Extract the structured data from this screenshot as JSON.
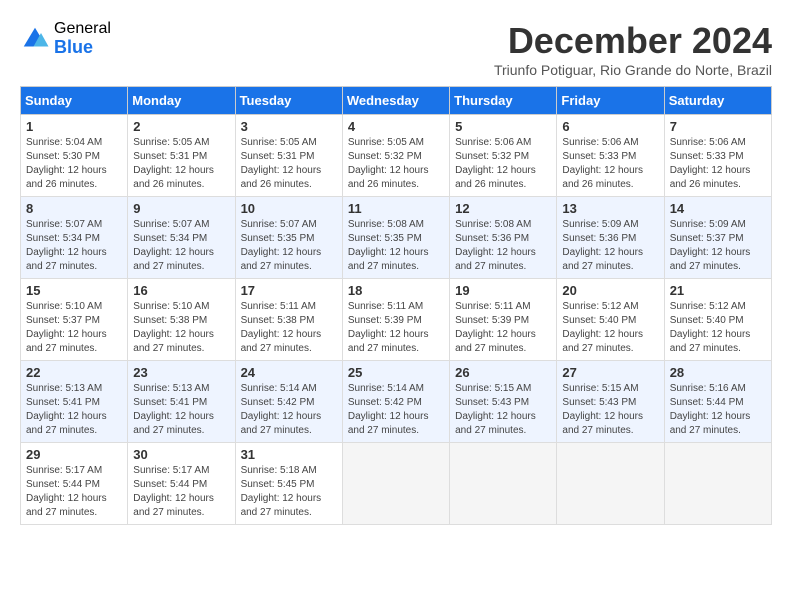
{
  "logo": {
    "general": "General",
    "blue": "Blue"
  },
  "title": "December 2024",
  "subtitle": "Triunfo Potiguar, Rio Grande do Norte, Brazil",
  "weekdays": [
    "Sunday",
    "Monday",
    "Tuesday",
    "Wednesday",
    "Thursday",
    "Friday",
    "Saturday"
  ],
  "weeks": [
    [
      {
        "day": "1",
        "sunrise": "5:04 AM",
        "sunset": "5:30 PM",
        "daylight": "12 hours and 26 minutes."
      },
      {
        "day": "2",
        "sunrise": "5:05 AM",
        "sunset": "5:31 PM",
        "daylight": "12 hours and 26 minutes."
      },
      {
        "day": "3",
        "sunrise": "5:05 AM",
        "sunset": "5:31 PM",
        "daylight": "12 hours and 26 minutes."
      },
      {
        "day": "4",
        "sunrise": "5:05 AM",
        "sunset": "5:32 PM",
        "daylight": "12 hours and 26 minutes."
      },
      {
        "day": "5",
        "sunrise": "5:06 AM",
        "sunset": "5:32 PM",
        "daylight": "12 hours and 26 minutes."
      },
      {
        "day": "6",
        "sunrise": "5:06 AM",
        "sunset": "5:33 PM",
        "daylight": "12 hours and 26 minutes."
      },
      {
        "day": "7",
        "sunrise": "5:06 AM",
        "sunset": "5:33 PM",
        "daylight": "12 hours and 26 minutes."
      }
    ],
    [
      {
        "day": "8",
        "sunrise": "5:07 AM",
        "sunset": "5:34 PM",
        "daylight": "12 hours and 27 minutes."
      },
      {
        "day": "9",
        "sunrise": "5:07 AM",
        "sunset": "5:34 PM",
        "daylight": "12 hours and 27 minutes."
      },
      {
        "day": "10",
        "sunrise": "5:07 AM",
        "sunset": "5:35 PM",
        "daylight": "12 hours and 27 minutes."
      },
      {
        "day": "11",
        "sunrise": "5:08 AM",
        "sunset": "5:35 PM",
        "daylight": "12 hours and 27 minutes."
      },
      {
        "day": "12",
        "sunrise": "5:08 AM",
        "sunset": "5:36 PM",
        "daylight": "12 hours and 27 minutes."
      },
      {
        "day": "13",
        "sunrise": "5:09 AM",
        "sunset": "5:36 PM",
        "daylight": "12 hours and 27 minutes."
      },
      {
        "day": "14",
        "sunrise": "5:09 AM",
        "sunset": "5:37 PM",
        "daylight": "12 hours and 27 minutes."
      }
    ],
    [
      {
        "day": "15",
        "sunrise": "5:10 AM",
        "sunset": "5:37 PM",
        "daylight": "12 hours and 27 minutes."
      },
      {
        "day": "16",
        "sunrise": "5:10 AM",
        "sunset": "5:38 PM",
        "daylight": "12 hours and 27 minutes."
      },
      {
        "day": "17",
        "sunrise": "5:11 AM",
        "sunset": "5:38 PM",
        "daylight": "12 hours and 27 minutes."
      },
      {
        "day": "18",
        "sunrise": "5:11 AM",
        "sunset": "5:39 PM",
        "daylight": "12 hours and 27 minutes."
      },
      {
        "day": "19",
        "sunrise": "5:11 AM",
        "sunset": "5:39 PM",
        "daylight": "12 hours and 27 minutes."
      },
      {
        "day": "20",
        "sunrise": "5:12 AM",
        "sunset": "5:40 PM",
        "daylight": "12 hours and 27 minutes."
      },
      {
        "day": "21",
        "sunrise": "5:12 AM",
        "sunset": "5:40 PM",
        "daylight": "12 hours and 27 minutes."
      }
    ],
    [
      {
        "day": "22",
        "sunrise": "5:13 AM",
        "sunset": "5:41 PM",
        "daylight": "12 hours and 27 minutes."
      },
      {
        "day": "23",
        "sunrise": "5:13 AM",
        "sunset": "5:41 PM",
        "daylight": "12 hours and 27 minutes."
      },
      {
        "day": "24",
        "sunrise": "5:14 AM",
        "sunset": "5:42 PM",
        "daylight": "12 hours and 27 minutes."
      },
      {
        "day": "25",
        "sunrise": "5:14 AM",
        "sunset": "5:42 PM",
        "daylight": "12 hours and 27 minutes."
      },
      {
        "day": "26",
        "sunrise": "5:15 AM",
        "sunset": "5:43 PM",
        "daylight": "12 hours and 27 minutes."
      },
      {
        "day": "27",
        "sunrise": "5:15 AM",
        "sunset": "5:43 PM",
        "daylight": "12 hours and 27 minutes."
      },
      {
        "day": "28",
        "sunrise": "5:16 AM",
        "sunset": "5:44 PM",
        "daylight": "12 hours and 27 minutes."
      }
    ],
    [
      {
        "day": "29",
        "sunrise": "5:17 AM",
        "sunset": "5:44 PM",
        "daylight": "12 hours and 27 minutes."
      },
      {
        "day": "30",
        "sunrise": "5:17 AM",
        "sunset": "5:44 PM",
        "daylight": "12 hours and 27 minutes."
      },
      {
        "day": "31",
        "sunrise": "5:18 AM",
        "sunset": "5:45 PM",
        "daylight": "12 hours and 27 minutes."
      },
      null,
      null,
      null,
      null
    ]
  ]
}
